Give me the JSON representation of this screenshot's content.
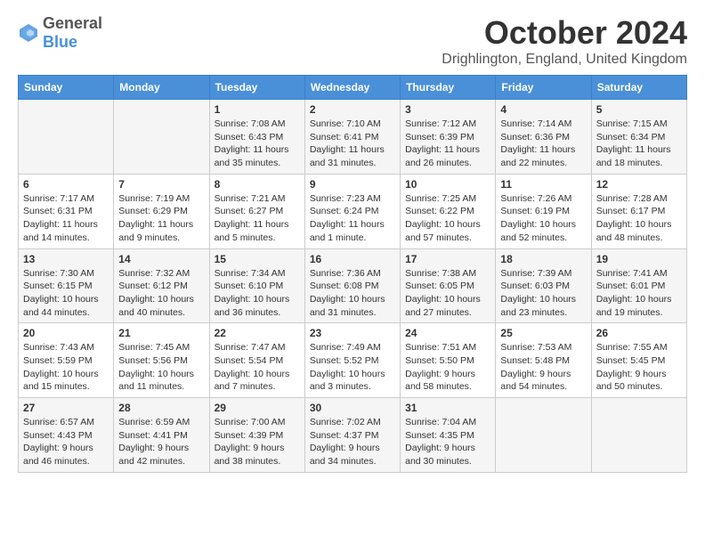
{
  "header": {
    "logo_general": "General",
    "logo_blue": "Blue",
    "month_title": "October 2024",
    "location": "Drighlington, England, United Kingdom"
  },
  "days_of_week": [
    "Sunday",
    "Monday",
    "Tuesday",
    "Wednesday",
    "Thursday",
    "Friday",
    "Saturday"
  ],
  "weeks": [
    [
      {
        "day": "",
        "content": ""
      },
      {
        "day": "",
        "content": ""
      },
      {
        "day": "1",
        "content": "Sunrise: 7:08 AM\nSunset: 6:43 PM\nDaylight: 11 hours and 35 minutes."
      },
      {
        "day": "2",
        "content": "Sunrise: 7:10 AM\nSunset: 6:41 PM\nDaylight: 11 hours and 31 minutes."
      },
      {
        "day": "3",
        "content": "Sunrise: 7:12 AM\nSunset: 6:39 PM\nDaylight: 11 hours and 26 minutes."
      },
      {
        "day": "4",
        "content": "Sunrise: 7:14 AM\nSunset: 6:36 PM\nDaylight: 11 hours and 22 minutes."
      },
      {
        "day": "5",
        "content": "Sunrise: 7:15 AM\nSunset: 6:34 PM\nDaylight: 11 hours and 18 minutes."
      }
    ],
    [
      {
        "day": "6",
        "content": "Sunrise: 7:17 AM\nSunset: 6:31 PM\nDaylight: 11 hours and 14 minutes."
      },
      {
        "day": "7",
        "content": "Sunrise: 7:19 AM\nSunset: 6:29 PM\nDaylight: 11 hours and 9 minutes."
      },
      {
        "day": "8",
        "content": "Sunrise: 7:21 AM\nSunset: 6:27 PM\nDaylight: 11 hours and 5 minutes."
      },
      {
        "day": "9",
        "content": "Sunrise: 7:23 AM\nSunset: 6:24 PM\nDaylight: 11 hours and 1 minute."
      },
      {
        "day": "10",
        "content": "Sunrise: 7:25 AM\nSunset: 6:22 PM\nDaylight: 10 hours and 57 minutes."
      },
      {
        "day": "11",
        "content": "Sunrise: 7:26 AM\nSunset: 6:19 PM\nDaylight: 10 hours and 52 minutes."
      },
      {
        "day": "12",
        "content": "Sunrise: 7:28 AM\nSunset: 6:17 PM\nDaylight: 10 hours and 48 minutes."
      }
    ],
    [
      {
        "day": "13",
        "content": "Sunrise: 7:30 AM\nSunset: 6:15 PM\nDaylight: 10 hours and 44 minutes."
      },
      {
        "day": "14",
        "content": "Sunrise: 7:32 AM\nSunset: 6:12 PM\nDaylight: 10 hours and 40 minutes."
      },
      {
        "day": "15",
        "content": "Sunrise: 7:34 AM\nSunset: 6:10 PM\nDaylight: 10 hours and 36 minutes."
      },
      {
        "day": "16",
        "content": "Sunrise: 7:36 AM\nSunset: 6:08 PM\nDaylight: 10 hours and 31 minutes."
      },
      {
        "day": "17",
        "content": "Sunrise: 7:38 AM\nSunset: 6:05 PM\nDaylight: 10 hours and 27 minutes."
      },
      {
        "day": "18",
        "content": "Sunrise: 7:39 AM\nSunset: 6:03 PM\nDaylight: 10 hours and 23 minutes."
      },
      {
        "day": "19",
        "content": "Sunrise: 7:41 AM\nSunset: 6:01 PM\nDaylight: 10 hours and 19 minutes."
      }
    ],
    [
      {
        "day": "20",
        "content": "Sunrise: 7:43 AM\nSunset: 5:59 PM\nDaylight: 10 hours and 15 minutes."
      },
      {
        "day": "21",
        "content": "Sunrise: 7:45 AM\nSunset: 5:56 PM\nDaylight: 10 hours and 11 minutes."
      },
      {
        "day": "22",
        "content": "Sunrise: 7:47 AM\nSunset: 5:54 PM\nDaylight: 10 hours and 7 minutes."
      },
      {
        "day": "23",
        "content": "Sunrise: 7:49 AM\nSunset: 5:52 PM\nDaylight: 10 hours and 3 minutes."
      },
      {
        "day": "24",
        "content": "Sunrise: 7:51 AM\nSunset: 5:50 PM\nDaylight: 9 hours and 58 minutes."
      },
      {
        "day": "25",
        "content": "Sunrise: 7:53 AM\nSunset: 5:48 PM\nDaylight: 9 hours and 54 minutes."
      },
      {
        "day": "26",
        "content": "Sunrise: 7:55 AM\nSunset: 5:45 PM\nDaylight: 9 hours and 50 minutes."
      }
    ],
    [
      {
        "day": "27",
        "content": "Sunrise: 6:57 AM\nSunset: 4:43 PM\nDaylight: 9 hours and 46 minutes."
      },
      {
        "day": "28",
        "content": "Sunrise: 6:59 AM\nSunset: 4:41 PM\nDaylight: 9 hours and 42 minutes."
      },
      {
        "day": "29",
        "content": "Sunrise: 7:00 AM\nSunset: 4:39 PM\nDaylight: 9 hours and 38 minutes."
      },
      {
        "day": "30",
        "content": "Sunrise: 7:02 AM\nSunset: 4:37 PM\nDaylight: 9 hours and 34 minutes."
      },
      {
        "day": "31",
        "content": "Sunrise: 7:04 AM\nSunset: 4:35 PM\nDaylight: 9 hours and 30 minutes."
      },
      {
        "day": "",
        "content": ""
      },
      {
        "day": "",
        "content": ""
      }
    ]
  ]
}
